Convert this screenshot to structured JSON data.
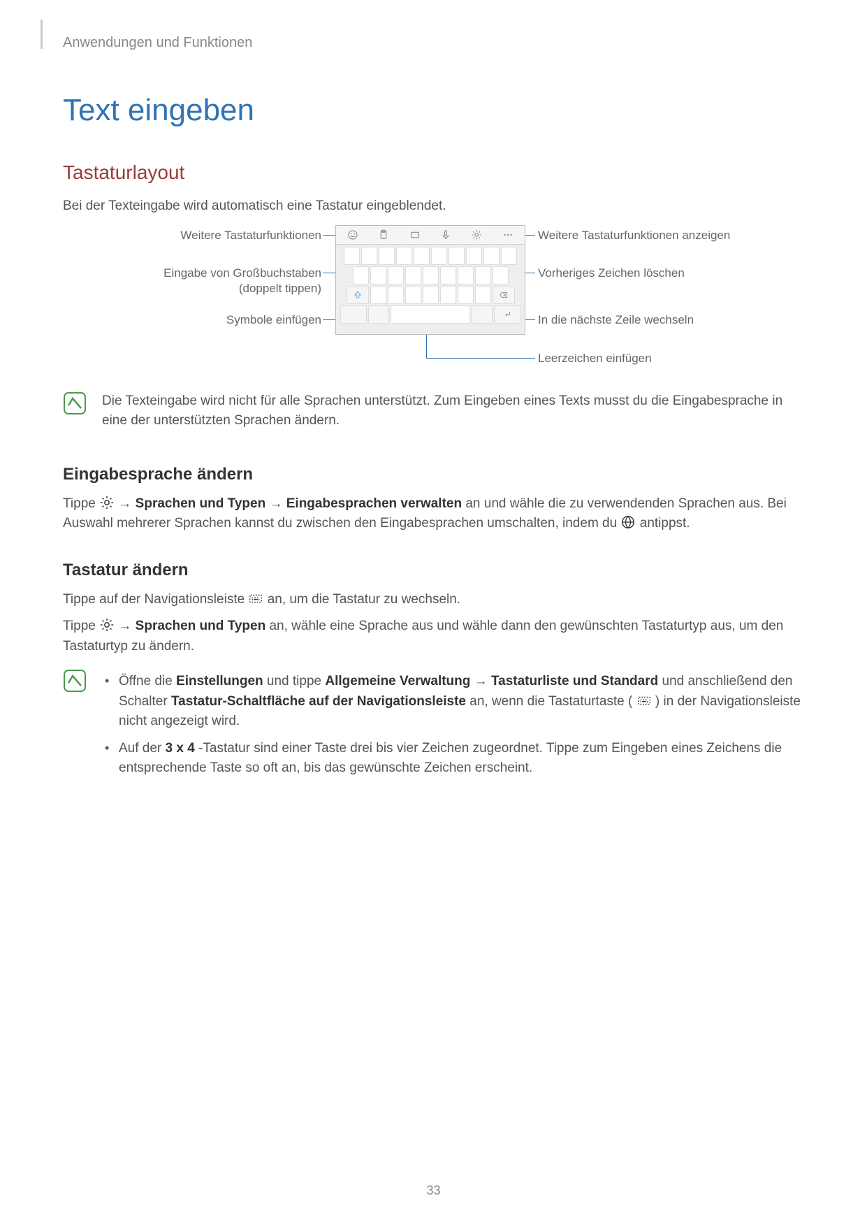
{
  "header": "Anwendungen und Funktionen",
  "page_title": "Text eingeben",
  "section1_title": "Tastaturlayout",
  "section1_intro": "Bei der Texteingabe wird automatisch eine Tastatur eingeblendet.",
  "diagram_labels": {
    "l1": "Weitere Tastaturfunktionen",
    "l2": "Eingabe von Großbuchstaben\n(doppelt tippen)",
    "l3": "Symbole einfügen",
    "r1": "Weitere Tastaturfunktionen anzeigen",
    "r2": "Vorheriges Zeichen löschen",
    "r3": "In die nächste Zeile wechseln",
    "r4": "Leerzeichen einfügen"
  },
  "note1": "Die Texteingabe wird nicht für alle Sprachen unterstützt. Zum Eingeben eines Texts musst du die Eingabesprache in eine der unterstützten Sprachen ändern.",
  "sub1_title": "Eingabesprache ändern",
  "sub1_p_pre": "Tippe ",
  "sub1_p_b1": "Sprachen und Typen",
  "sub1_p_b2": "Eingabesprachen verwalten",
  "sub1_p_mid": " an und wähle die zu verwendenden Sprachen aus. Bei Auswahl mehrerer Sprachen kannst du zwischen den Eingabesprachen umschalten, indem du ",
  "sub1_p_end": " antippst.",
  "sub2_title": "Tastatur ändern",
  "sub2_p1_pre": "Tippe auf der Navigationsleiste ",
  "sub2_p1_post": " an, um die Tastatur zu wechseln.",
  "sub2_p2_pre": "Tippe ",
  "sub2_p2_b1": "Sprachen und Typen",
  "sub2_p2_post": " an, wähle eine Sprache aus und wähle dann den gewünschten Tastaturtyp aus, um den Tastaturtyp zu ändern.",
  "note2_b1_pre": "Öffne die ",
  "note2_b1_s1": "Einstellungen",
  "note2_b1_mid1": " und tippe ",
  "note2_b1_s2": "Allgemeine Verwaltung",
  "note2_b1_s3": "Tastaturliste und Standard",
  "note2_b1_mid2": " und anschließend den Schalter ",
  "note2_b1_s4": "Tastatur-Schaltfläche auf der Navigationsleiste",
  "note2_b1_mid3": " an, wenn die Tastaturtaste (",
  "note2_b1_end": ") in der Navigationsleiste nicht angezeigt wird.",
  "note2_b2_pre": "Auf der ",
  "note2_b2_s1": "3 x 4",
  "note2_b2_post": "-Tastatur sind einer Taste drei bis vier Zeichen zugeordnet. Tippe zum Eingeben eines Zeichens die entsprechende Taste so oft an, bis das gewünschte Zeichen erscheint.",
  "page_number": "33"
}
